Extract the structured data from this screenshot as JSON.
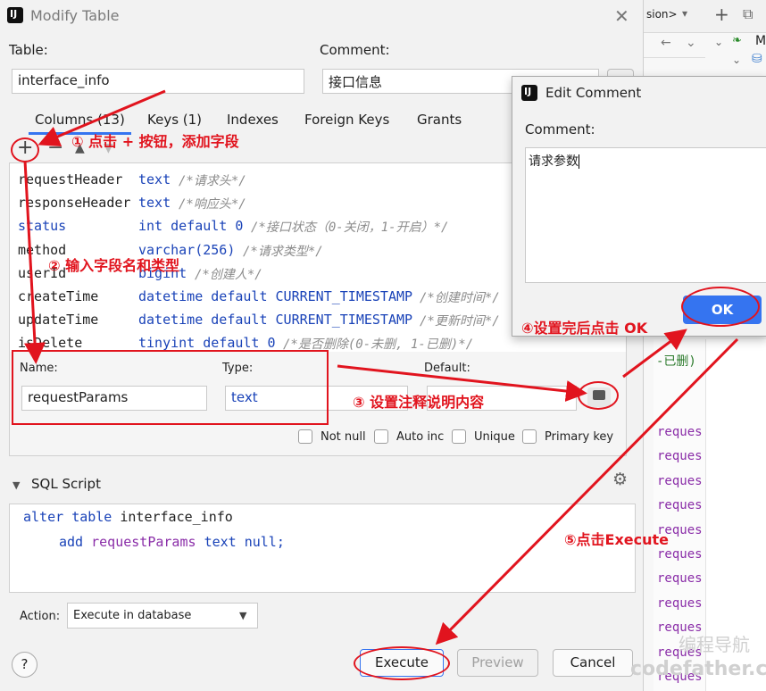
{
  "dialog": {
    "title": "Modify Table",
    "table_label": "Table:",
    "table_value": "interface_info",
    "comment_label": "Comment:",
    "comment_value": "接口信息",
    "tabs": [
      "Columns (13)",
      "Keys (1)",
      "Indexes",
      "Foreign Keys",
      "Grants"
    ],
    "columns": [
      {
        "name": "requestHeader",
        "type": "text",
        "comment": "/*请求头*/"
      },
      {
        "name": "responseHeader",
        "type": "text",
        "comment": "/*响应头*/"
      },
      {
        "name": "status",
        "type": "int default 0",
        "comment": "/*接口状态（0-关闭，1-开启）*/"
      },
      {
        "name": "method",
        "type": "varchar(256)",
        "comment": "/*请求类型*/"
      },
      {
        "name": "userId",
        "type": "bigint",
        "comment": "/*创建人*/"
      },
      {
        "name": "createTime",
        "type": "datetime default CURRENT_TIMESTAMP",
        "comment": "/*创建时间*/"
      },
      {
        "name": "updateTime",
        "type": "datetime default CURRENT_TIMESTAMP",
        "comment": "/*更新时间*/"
      },
      {
        "name": "isDelete",
        "type": "tinyint default 0",
        "comment": "/*是否删除(0-未删, 1-已删)*/"
      }
    ],
    "name_label": "Name:",
    "name_value": "requestParams",
    "type_label": "Type:",
    "type_value": "text",
    "default_label": "Default:",
    "checkboxes": [
      "Not null",
      "Auto inc",
      "Unique",
      "Primary key"
    ],
    "sql_title": "SQL Script",
    "sql_line1": "alter table interface_info",
    "sql_line2": "add requestParams text null;",
    "action_label": "Action:",
    "action_value": "Execute in database",
    "buttons": {
      "execute": "Execute",
      "preview": "Preview",
      "cancel": "Cancel",
      "help": "?"
    }
  },
  "edit_comment": {
    "title": "Edit Comment",
    "label": "Comment:",
    "value": "请求参数",
    "ok": "OK"
  },
  "ide": {
    "tab_fragment": "sion>",
    "code_fragment": "-已删)",
    "lines": [
      "reques",
      "reques",
      "reques",
      "reques",
      "reques",
      "reques",
      "reques",
      "reques",
      "reques",
      "reques",
      "reques"
    ]
  },
  "annotations": {
    "step1": "① 点击 + 按钮，添加字段",
    "step2": "② 输入字段名和类型",
    "step3": "③ 设置注释说明内容",
    "step4": "④设置完后点击 OK",
    "step5": "⑤点击Execute"
  },
  "watermark": {
    "line1": "编程导航",
    "line2": "codefather.cn"
  },
  "colors": {
    "annotation": "#e1141e",
    "keyword": "#1a43b8",
    "ok_button": "#3574f0"
  }
}
